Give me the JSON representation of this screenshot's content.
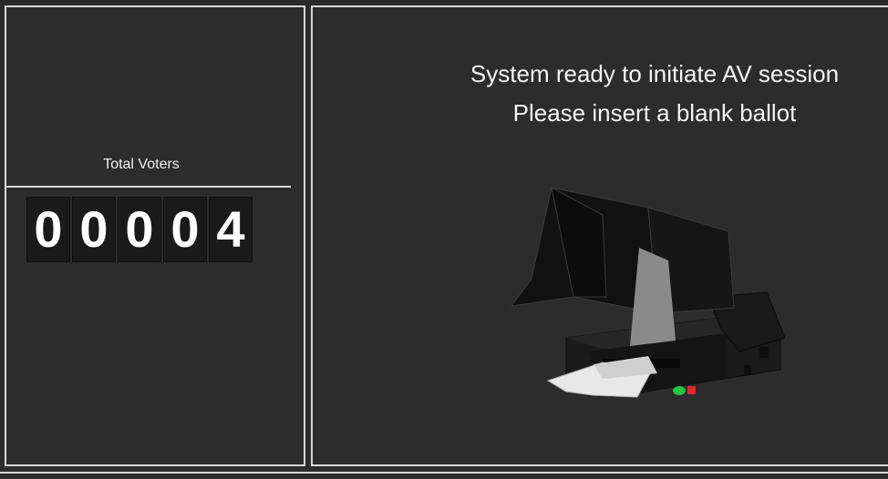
{
  "counter": {
    "label": "Total Voters",
    "digits": [
      "0",
      "0",
      "0",
      "0",
      "4"
    ]
  },
  "status": {
    "line1": "System ready to initiate AV session",
    "line2": "Please insert a blank ballot"
  },
  "illustration": {
    "icon": "ballot-scanner-machine-icon"
  },
  "colors": {
    "background": "#2c2c2c",
    "border": "#d9d9d9",
    "digit_bg": "#1a1a1a",
    "text": "#ffffff",
    "led_green": "#22c43a",
    "led_red": "#e0242a"
  }
}
